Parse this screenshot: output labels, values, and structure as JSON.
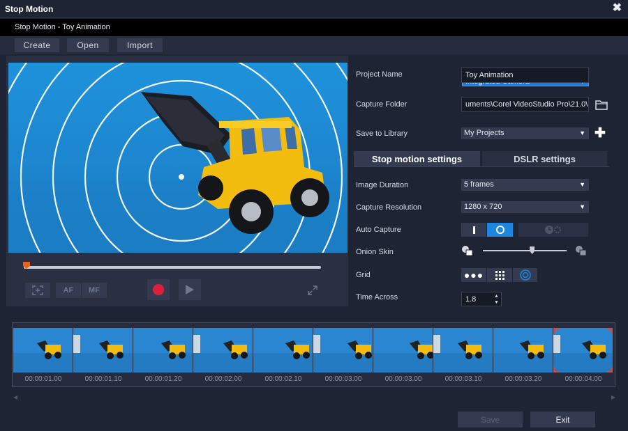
{
  "window": {
    "title": "Stop Motion",
    "subtitle": "Stop Motion - Toy Animation",
    "close_glyph": "✖"
  },
  "menu": {
    "create": "Create",
    "open": "Open",
    "import": "Import"
  },
  "camera": {
    "selected": "Integrated Camera"
  },
  "project": {
    "name_label": "Project Name",
    "name_value": "Toy Animation",
    "folder_label": "Capture Folder",
    "folder_value": "uments\\Corel VideoStudio Pro\\21.0\\",
    "library_label": "Save to Library",
    "library_value": "My Projects"
  },
  "tabs": {
    "stop_motion": "Stop motion settings",
    "dslr": "DSLR settings",
    "active": "stop_motion"
  },
  "settings": {
    "image_duration_label": "Image Duration",
    "image_duration_value": "5 frames",
    "capture_resolution_label": "Capture Resolution",
    "capture_resolution_value": "1280 x 720",
    "auto_capture_label": "Auto Capture",
    "onion_skin_label": "Onion Skin",
    "onion_skin_level": 0.6,
    "grid_label": "Grid",
    "time_across_label": "Time Across",
    "time_across_value": "1.8"
  },
  "controls": {
    "af": "AF",
    "mf": "MF",
    "scrub_position": 0.0
  },
  "timeline": {
    "timecodes": [
      "00:00:01.00",
      "00:00:01.10",
      "00:00:01.20",
      "00:00:02.00",
      "00:00:02.10",
      "00:00:03.00",
      "00:00:03.00",
      "00:00:03.10",
      "00:00:03.20",
      "00:00:04.00"
    ],
    "selected_index": 9
  },
  "footer": {
    "save": "Save",
    "exit": "Exit"
  },
  "colors": {
    "accent": "#1c86e0",
    "record": "#e0203a",
    "scrub_thumb": "#e8631d",
    "selection": "#e0453b"
  }
}
